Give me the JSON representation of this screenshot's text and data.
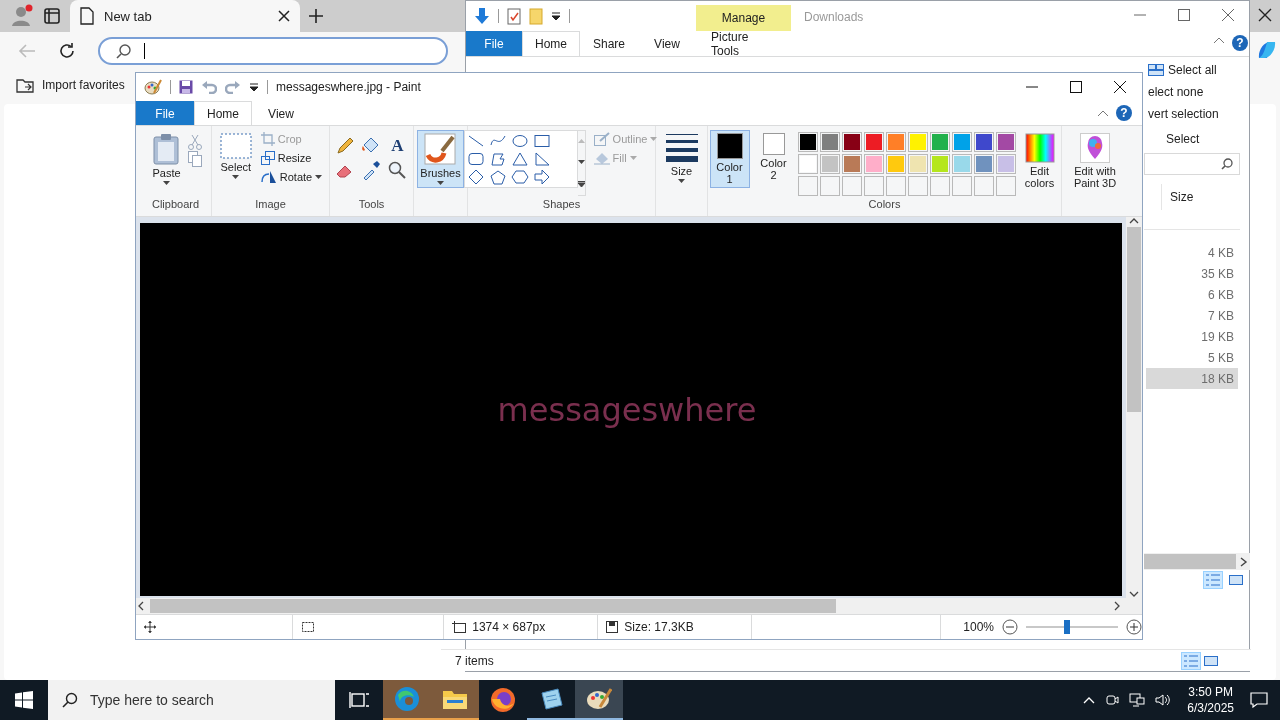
{
  "browser": {
    "tabs": [
      {
        "label": "New tab",
        "selected": true
      }
    ],
    "favorites": [
      {
        "label": "Import favorites"
      }
    ]
  },
  "explorer": {
    "title": "Downloads",
    "context_label": "Manage",
    "help": "?",
    "tabs": [
      {
        "label": "File",
        "kind": "file",
        "selected": false
      },
      {
        "label": "Home",
        "kind": "tab",
        "selected": true
      },
      {
        "label": "Share",
        "kind": "tab",
        "selected": false
      },
      {
        "label": "View",
        "kind": "tab",
        "selected": false
      },
      {
        "label": "Picture Tools",
        "kind": "context",
        "selected": false
      }
    ],
    "select_commands": [
      "Select all",
      "elect none",
      "vert selection"
    ],
    "select_group": "Select",
    "column": "Size",
    "rows": [
      {
        "size": "4 KB",
        "selected": false
      },
      {
        "size": "35 KB",
        "selected": false
      },
      {
        "size": "6 KB",
        "selected": false
      },
      {
        "size": "7 KB",
        "selected": false
      },
      {
        "size": "19 KB",
        "selected": false
      },
      {
        "size": "5 KB",
        "selected": false
      },
      {
        "size": "18 KB",
        "selected": true
      }
    ],
    "status": "7 items"
  },
  "paint": {
    "title": "messageswhere.jpg - Paint",
    "help": "?",
    "tabs": [
      {
        "label": "File",
        "kind": "file",
        "selected": false
      },
      {
        "label": "Home",
        "kind": "tab",
        "selected": true
      },
      {
        "label": "View",
        "kind": "tab",
        "selected": false
      }
    ],
    "clipboard": {
      "paste": "Paste",
      "label": "Clipboard"
    },
    "image": {
      "select": "Select",
      "label": "Image",
      "commands": [
        {
          "label": "Crop",
          "kind": "crop",
          "disabled": true
        },
        {
          "label": "Resize",
          "kind": "resize",
          "disabled": false
        },
        {
          "label": "Rotate",
          "kind": "rotate",
          "disabled": false
        }
      ]
    },
    "tools": {
      "text_tool": "A",
      "label": "Tools"
    },
    "brushes": {
      "label": "Brushes",
      "selected": true
    },
    "shapes": {
      "label": "Shapes",
      "outline": {
        "label": "Outline",
        "disabled": true
      },
      "fill": {
        "label": "Fill",
        "disabled": true
      }
    },
    "size_label": "Size",
    "color_slots": [
      {
        "label": "Color 1",
        "color": "#000000",
        "selected": true
      },
      {
        "label": "Color 2",
        "color": "#ffffff",
        "selected": false
      }
    ],
    "palette": [
      {
        "kind": "swatch",
        "color": "#000000"
      },
      {
        "kind": "swatch",
        "color": "#7f7f7f"
      },
      {
        "kind": "swatch",
        "color": "#880015"
      },
      {
        "kind": "swatch",
        "color": "#ed1c24"
      },
      {
        "kind": "swatch",
        "color": "#ff7f27"
      },
      {
        "kind": "swatch",
        "color": "#fff200"
      },
      {
        "kind": "swatch",
        "color": "#22b14c"
      },
      {
        "kind": "swatch",
        "color": "#00a2e8"
      },
      {
        "kind": "swatch",
        "color": "#3f48cc"
      },
      {
        "kind": "swatch",
        "color": "#a349a4"
      },
      {
        "kind": "swatch",
        "color": "#ffffff"
      },
      {
        "kind": "swatch",
        "color": "#c3c3c3"
      },
      {
        "kind": "swatch",
        "color": "#b97a57"
      },
      {
        "kind": "swatch",
        "color": "#ffaec9"
      },
      {
        "kind": "swatch",
        "color": "#ffc90e"
      },
      {
        "kind": "swatch",
        "color": "#efe4b0"
      },
      {
        "kind": "swatch",
        "color": "#b5e61d"
      },
      {
        "kind": "swatch",
        "color": "#99d9ea"
      },
      {
        "kind": "swatch",
        "color": "#7092be"
      },
      {
        "kind": "swatch",
        "color": "#c8bfe7"
      },
      {
        "kind": "empty"
      },
      {
        "kind": "empty"
      },
      {
        "kind": "empty"
      },
      {
        "kind": "empty"
      },
      {
        "kind": "empty"
      },
      {
        "kind": "empty"
      },
      {
        "kind": "empty"
      },
      {
        "kind": "empty"
      },
      {
        "kind": "empty"
      },
      {
        "kind": "empty"
      }
    ],
    "edit_colors": "Edit colors",
    "colors_label": "Colors",
    "paint3d": "Edit with Paint 3D",
    "canvas_text": "messageswhere",
    "status": {
      "dimensions": "1374 × 687px",
      "file_size": "Size: 17.3KB",
      "zoom": "100%",
      "zoom_slider": {
        "level": 0.45
      }
    }
  },
  "taskbar": {
    "search_placeholder": "Type here to search",
    "apps": [
      {
        "kind": "edge",
        "flashing": true,
        "selected": false
      },
      {
        "kind": "explorer",
        "flashing": true,
        "selected": false
      },
      {
        "kind": "firefox",
        "flashing": false,
        "selected": false
      },
      {
        "kind": "notepad",
        "flashing": false,
        "selected": false
      },
      {
        "kind": "paint",
        "flashing": false,
        "selected": true
      }
    ],
    "time": "3:50 PM",
    "date": "6/3/2025"
  }
}
